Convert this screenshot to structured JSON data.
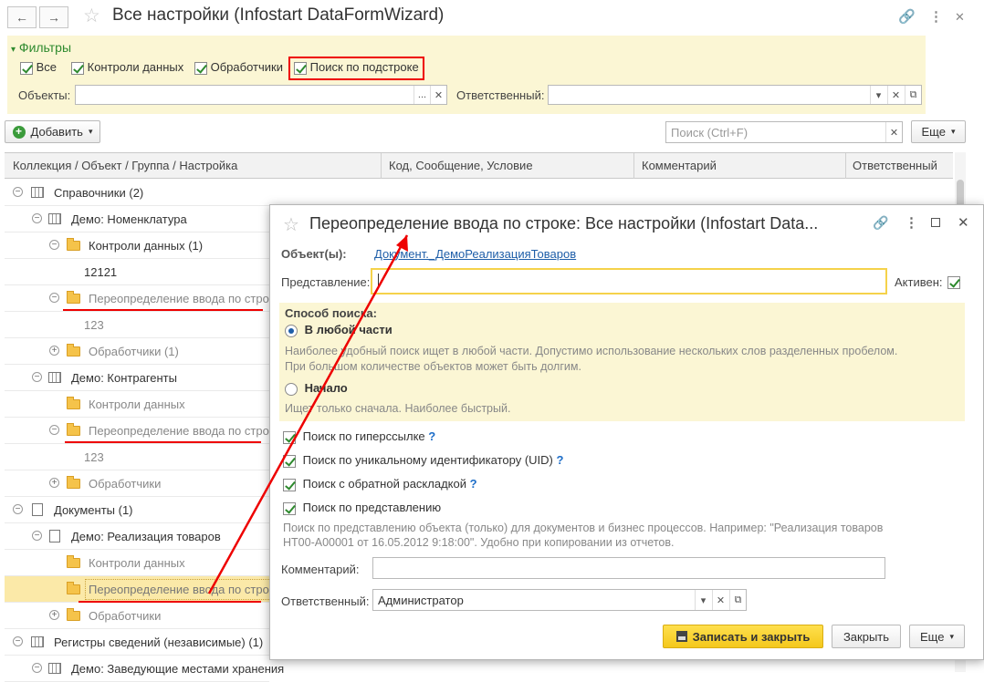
{
  "window": {
    "title": "Все настройки (Infostart DataFormWizard)",
    "back": "←",
    "forward": "→"
  },
  "filters": {
    "heading": "Фильтры",
    "checkboxes": [
      {
        "label": "Все",
        "checked": true
      },
      {
        "label": "Контроли данных",
        "checked": true
      },
      {
        "label": "Обработчики",
        "checked": true
      },
      {
        "label": "Поиск по подстроке",
        "checked": true
      }
    ],
    "objects_label": "Объекты:",
    "objects_value": "",
    "responsible_label": "Ответственный:",
    "responsible_value": ""
  },
  "toolbar": {
    "add_label": "Добавить",
    "search_placeholder": "Поиск (Ctrl+F)",
    "more_label": "Еще"
  },
  "grid": {
    "columns": [
      "Коллекция / Объект / Группа / Настройка",
      "Код, Сообщение, Условие",
      "Комментарий",
      "Ответственный"
    ],
    "rows": [
      {
        "text": "Справочники (2)"
      },
      {
        "text": "Демо: Номенклатура"
      },
      {
        "text": "Контроли данных (1)"
      },
      {
        "text": "12121"
      },
      {
        "text": "Переопределение ввода по стро"
      },
      {
        "text": "123"
      },
      {
        "text": "Обработчики (1)"
      },
      {
        "text": "Демо: Контрагенты"
      },
      {
        "text": "Контроли данных"
      },
      {
        "text": "Переопределение ввода по стро"
      },
      {
        "text": "123"
      },
      {
        "text": "Обработчики"
      },
      {
        "text": "Документы (1)"
      },
      {
        "text": "Демо: Реализация товаров"
      },
      {
        "text": "Контроли данных"
      },
      {
        "text": "Переопределение ввода по стро"
      },
      {
        "text": "Обработчики"
      },
      {
        "text": "Регистры сведений (независимые) (1)"
      },
      {
        "text": "Демо: Заведующие местами хранения"
      }
    ]
  },
  "dialog": {
    "title": "Переопределение ввода по строке: Все настройки (Infostart Data...",
    "objects_label": "Объект(ы):",
    "objects_link": "Документ._ДемоРеализацияТоваров",
    "repr_label": "Представление:",
    "repr_value": "",
    "active_label": "Активен:",
    "active_checked": true,
    "search_mode_heading": "Способ поиска:",
    "mode_any": "В любой части",
    "mode_any_selected": true,
    "mode_any_hint_1": "Наиболее удобный поиск ищет в любой части. Допустимо использование нескольких слов разделенных пробелом.",
    "mode_any_hint_2": "При большом количестве объектов может быть долгим.",
    "mode_start": "Начало",
    "mode_start_hint": "Ищет только сначала. Наиболее быстрый.",
    "options": [
      {
        "label": "Поиск по гиперссылке",
        "checked": true,
        "help": "?"
      },
      {
        "label": "Поиск по уникальному идентификатору (UID)",
        "checked": true,
        "help": "?"
      },
      {
        "label": "Поиск с обратной раскладкой",
        "checked": true,
        "help": "?"
      },
      {
        "label": "Поиск по представлению",
        "checked": true,
        "help": ""
      }
    ],
    "repr_hint_1": "Поиск по представлению объекта (только) для документов и бизнес процессов. Например: \"Реализация товаров",
    "repr_hint_2": "НТ00-А00001 от 16.05.2012 9:18:00\". Удобно при копировании из отчетов.",
    "comment_label": "Комментарий:",
    "comment_value": "",
    "responsible_label": "Ответственный:",
    "responsible_value": "Администратор",
    "save_close_label": "Записать и закрыть",
    "close_label": "Закрыть",
    "more_label": "Еще"
  },
  "colors": {
    "accent": "#ffd82c",
    "filter_bg": "#fbf6d4",
    "highlight": "#e00000",
    "link": "#1e5ea8"
  }
}
